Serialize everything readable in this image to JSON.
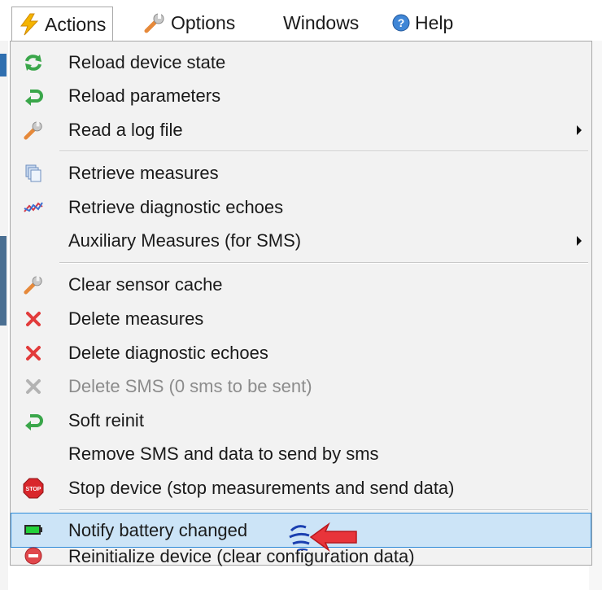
{
  "menubar": {
    "items": [
      {
        "label": "Actions",
        "icon": "lightning-icon"
      },
      {
        "label": "Options",
        "icon": "wrench-icon"
      },
      {
        "label": "Windows"
      },
      {
        "label": "Help",
        "icon": "help-icon"
      }
    ]
  },
  "actions_menu": {
    "items": [
      {
        "label": "Reload device state",
        "icon": "refresh-icon"
      },
      {
        "label": "Reload parameters",
        "icon": "return-arrow-icon"
      },
      {
        "label": "Read a log file",
        "icon": "wrench-icon",
        "submenu": true
      },
      {
        "label": "Retrieve measures",
        "icon": "documents-icon"
      },
      {
        "label": "Retrieve diagnostic echoes",
        "icon": "graph-icon"
      },
      {
        "label": "Auxiliary Measures (for SMS)",
        "submenu": true
      },
      {
        "label": "Clear sensor cache",
        "icon": "wrench-icon"
      },
      {
        "label": "Delete measures",
        "icon": "red-x-icon"
      },
      {
        "label": "Delete diagnostic echoes",
        "icon": "red-x-icon"
      },
      {
        "label": "Delete SMS (0 sms to be sent)",
        "icon": "gray-x-icon",
        "disabled": true
      },
      {
        "label": "Soft reinit",
        "icon": "return-arrow-icon"
      },
      {
        "label": "Remove SMS and data to send by sms"
      },
      {
        "label": "Stop device (stop measurements and send data)",
        "icon": "stop-sign-icon",
        "stop_text": "STOP"
      },
      {
        "label": "Notify battery changed",
        "icon": "battery-icon",
        "highlighted": true
      },
      {
        "label": "Reinitialize device (clear configuration  data)",
        "icon": "no-entry-icon"
      }
    ]
  },
  "colors": {
    "highlight_bg": "#cce4f7",
    "highlight_border": "#2f8bd8",
    "menu_bg": "#f2f2f2",
    "cursor": "#e8343a"
  }
}
